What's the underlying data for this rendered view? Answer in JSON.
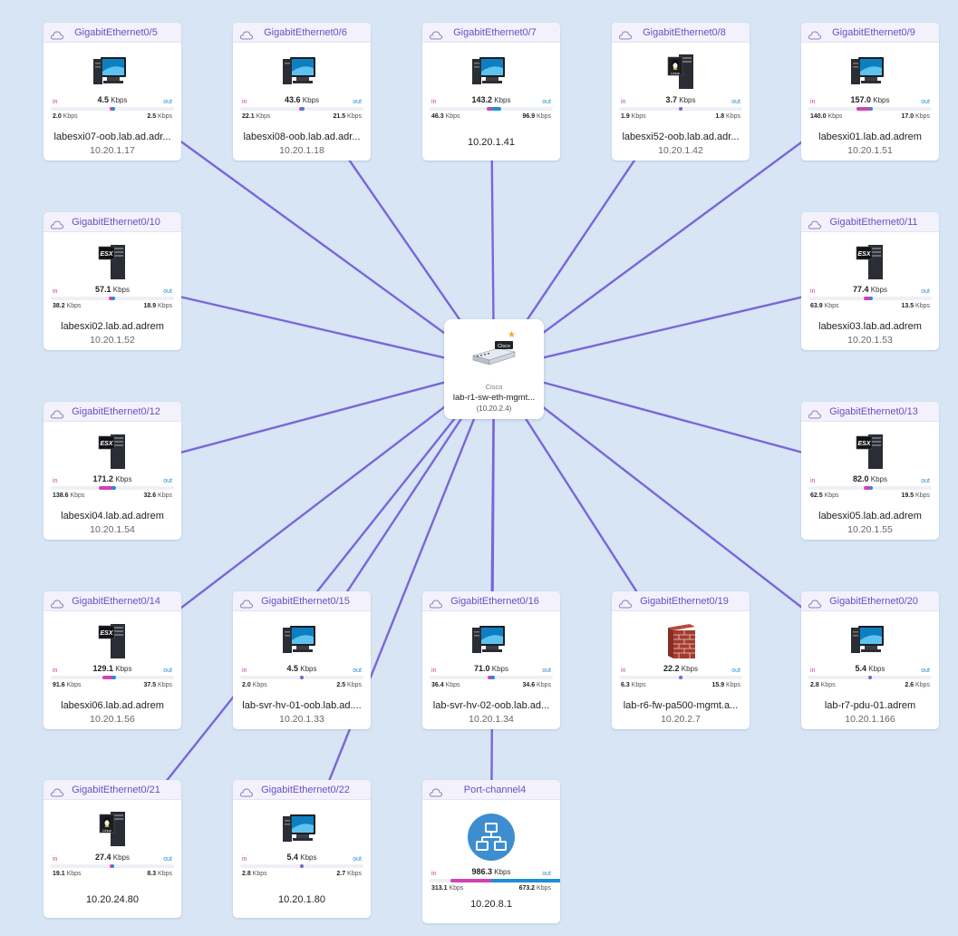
{
  "center": {
    "vendor": "Cisco",
    "name": "lab-r1-sw-eth-mgmt...",
    "ip": "(10.20.2.4)"
  },
  "labels": {
    "in": "in",
    "out": "out",
    "unit": "Kbps"
  },
  "colors": {
    "link": "#7a66d9",
    "in_bar": "#d442b2",
    "out_bar": "#1c8fd6",
    "background": "#d7e5f5"
  },
  "nodes": [
    {
      "iface": "GigabitEthernet0/5",
      "icon": "monitor",
      "rate": "4.5",
      "in": "2.0",
      "out": "2.5",
      "name": "labesxi07-oob.lab.ad.adr...",
      "ip": "10.20.1.17",
      "in_fill": 0.02,
      "out_fill": 0.02
    },
    {
      "iface": "GigabitEthernet0/6",
      "icon": "tower",
      "rate": "43.6",
      "in": "22.1",
      "out": "21.5",
      "name": "labesxi08-oob.lab.ad.adr...",
      "ip": "10.20.1.18",
      "in_fill": 0.02,
      "out_fill": 0.02
    },
    {
      "iface": "GigabitEthernet0/7",
      "icon": "monitor",
      "rate": "143.2",
      "in": "46.3",
      "out": "96.9",
      "name": "",
      "ip": "10.20.1.41",
      "in_fill": 0.04,
      "out_fill": 0.08
    },
    {
      "iface": "GigabitEthernet0/8",
      "icon": "linux-tower",
      "rate": "3.7",
      "in": "1.9",
      "out": "1.8",
      "name": "labesxi52-oob.lab.ad.adr...",
      "ip": "10.20.1.42",
      "in_fill": 0.01,
      "out_fill": 0.01
    },
    {
      "iface": "GigabitEthernet0/9",
      "icon": "monitor",
      "rate": "157.0",
      "in": "140.0",
      "out": "17.0",
      "name": "labesxi01.lab.ad.adrem",
      "ip": "10.20.1.51",
      "in_fill": 0.11,
      "out_fill": 0.02
    },
    {
      "iface": "GigabitEthernet0/10",
      "icon": "esx-tower",
      "rate": "57.1",
      "in": "38.2",
      "out": "18.9",
      "name": "labesxi02.lab.ad.adrem",
      "ip": "10.20.1.52",
      "in_fill": 0.03,
      "out_fill": 0.02
    },
    {
      "iface": "GigabitEthernet0/11",
      "icon": "esx-tower",
      "rate": "77.4",
      "in": "63.9",
      "out": "13.5",
      "name": "labesxi03.lab.ad.adrem",
      "ip": "10.20.1.53",
      "in_fill": 0.05,
      "out_fill": 0.02
    },
    {
      "iface": "GigabitEthernet0/12",
      "icon": "esx-tower",
      "rate": "171.2",
      "in": "138.6",
      "out": "32.6",
      "name": "labesxi04.lab.ad.adrem",
      "ip": "10.20.1.54",
      "in_fill": 0.11,
      "out_fill": 0.03
    },
    {
      "iface": "GigabitEthernet0/13",
      "icon": "esx-tower",
      "rate": "82.0",
      "in": "62.5",
      "out": "19.5",
      "name": "labesxi05.lab.ad.adrem",
      "ip": "10.20.1.55",
      "in_fill": 0.05,
      "out_fill": 0.02
    },
    {
      "iface": "GigabitEthernet0/14",
      "icon": "esx-tower",
      "rate": "129.1",
      "in": "91.6",
      "out": "37.5",
      "name": "labesxi06.lab.ad.adrem",
      "ip": "10.20.1.56",
      "in_fill": 0.08,
      "out_fill": 0.03
    },
    {
      "iface": "GigabitEthernet0/15",
      "icon": "monitor",
      "rate": "4.5",
      "in": "2.0",
      "out": "2.5",
      "name": "lab-svr-hv-01-oob.lab.ad....",
      "ip": "10.20.1.33",
      "in_fill": 0.01,
      "out_fill": 0.01
    },
    {
      "iface": "GigabitEthernet0/16",
      "icon": "monitor",
      "rate": "71.0",
      "in": "36.4",
      "out": "34.6",
      "name": "lab-svr-hv-02-oob.lab.ad...",
      "ip": "10.20.1.34",
      "in_fill": 0.03,
      "out_fill": 0.03
    },
    {
      "iface": "GigabitEthernet0/19",
      "icon": "firewall",
      "rate": "22.2",
      "in": "6.3",
      "out": "15.9",
      "name": "lab-r6-fw-pa500-mgmt.a...",
      "ip": "10.20.2.7",
      "in_fill": 0.01,
      "out_fill": 0.01
    },
    {
      "iface": "GigabitEthernet0/20",
      "icon": "monitor",
      "rate": "5.4",
      "in": "2.8",
      "out": "2.6",
      "name": "lab-r7-pdu-01.adrem",
      "ip": "10.20.1.166",
      "in_fill": 0.01,
      "out_fill": 0.01
    },
    {
      "iface": "GigabitEthernet0/21",
      "icon": "linux-tower",
      "rate": "27.4",
      "in": "19.1",
      "out": "8.3",
      "name": "",
      "ip": "10.20.24.80",
      "in_fill": 0.02,
      "out_fill": 0.01
    },
    {
      "iface": "GigabitEthernet0/22",
      "icon": "monitor",
      "rate": "5.4",
      "in": "2.8",
      "out": "2.7",
      "name": "",
      "ip": "10.20.1.80",
      "in_fill": 0.01,
      "out_fill": 0.01
    },
    {
      "iface": "Port-channel4",
      "icon": "network-hub",
      "rate": "986.3",
      "in": "313.1",
      "out": "673.2",
      "name": "",
      "ip": "10.20.8.1",
      "in_fill": 0.33,
      "out_fill": 0.67
    }
  ]
}
